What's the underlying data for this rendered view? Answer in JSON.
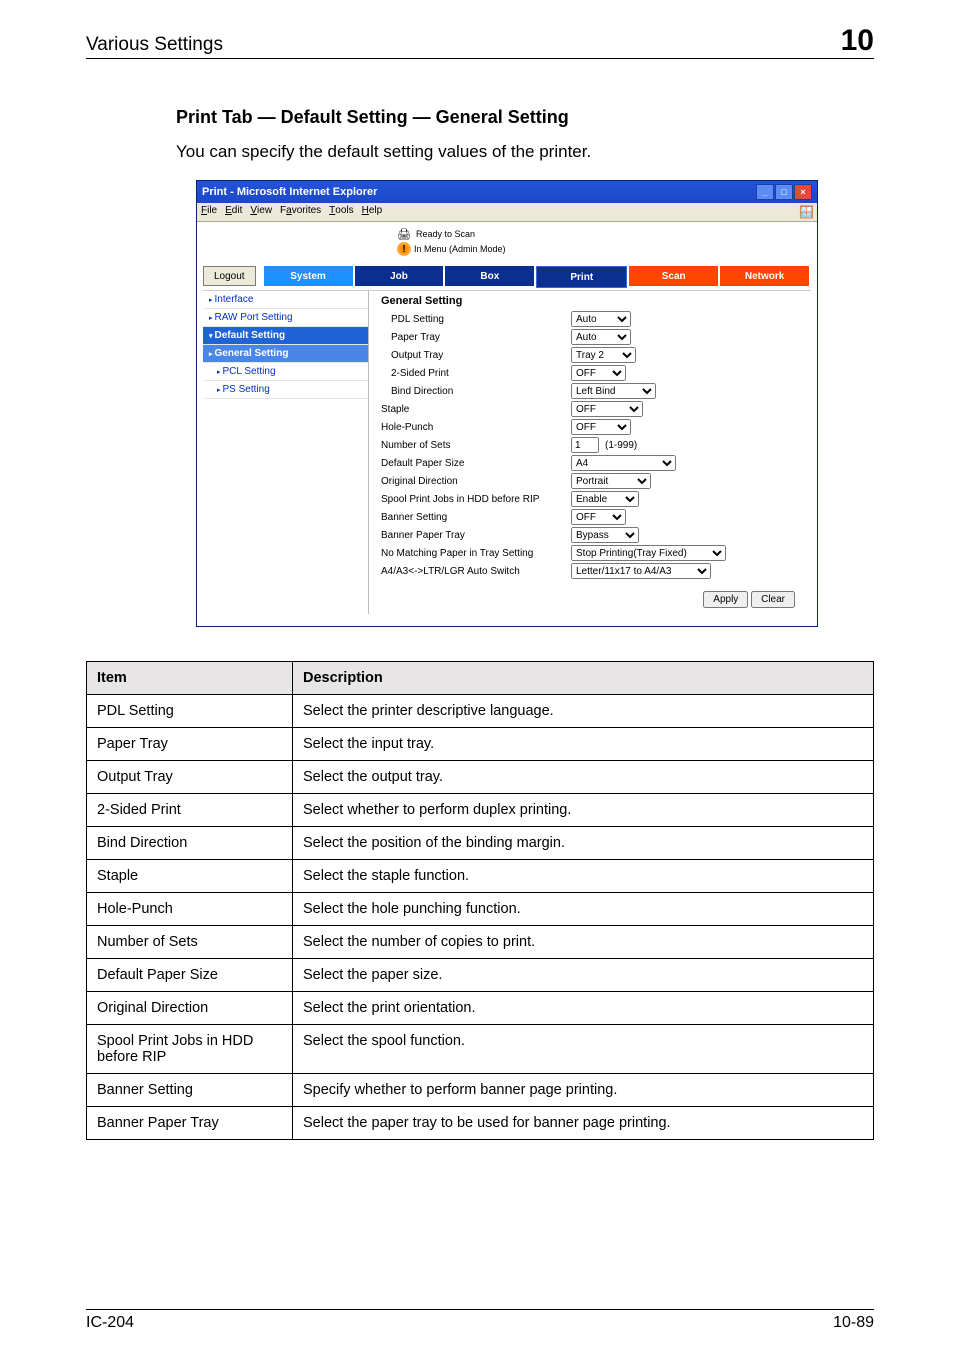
{
  "header": {
    "chapter_title": "Various Settings",
    "chapter_num": "10"
  },
  "section_title": "Print Tab — Default Setting — General Setting",
  "intro": "You can specify the default setting values of the printer.",
  "browser": {
    "title": "Print - Microsoft Internet Explorer",
    "menubar": [
      "File",
      "Edit",
      "View",
      "Favorites",
      "Tools",
      "Help"
    ],
    "status1": "Ready to Scan",
    "status2": "In Menu (Admin Mode)",
    "logout": "Logout",
    "tabs": {
      "system": "System",
      "job": "Job",
      "box": "Box",
      "print": "Print",
      "scan": "Scan",
      "network": "Network"
    },
    "sidebar": [
      "Interface",
      "RAW Port Setting",
      "Default Setting",
      "General Setting",
      "PCL Setting",
      "PS Setting"
    ],
    "main_title": "General Setting",
    "settings": {
      "pdl": {
        "label": "PDL Setting",
        "value": "Auto"
      },
      "paper_tray": {
        "label": "Paper Tray",
        "value": "Auto"
      },
      "output_tray": {
        "label": "Output Tray",
        "value": "Tray 2"
      },
      "duplex": {
        "label": "2-Sided Print",
        "value": "OFF"
      },
      "bind": {
        "label": "Bind Direction",
        "value": "Left Bind"
      },
      "staple": {
        "label": "Staple",
        "value": "OFF"
      },
      "punch": {
        "label": "Hole-Punch",
        "value": "OFF"
      },
      "num_sets": {
        "label": "Number of Sets",
        "value": "1",
        "range": "(1-999)"
      },
      "paper_size": {
        "label": "Default Paper Size",
        "value": "A4"
      },
      "orient": {
        "label": "Original Direction",
        "value": "Portrait"
      },
      "spool": {
        "label": "Spool Print Jobs in HDD before RIP",
        "value": "Enable"
      },
      "banner": {
        "label": "Banner Setting",
        "value": "OFF"
      },
      "banner_tray": {
        "label": "Banner Paper Tray",
        "value": "Bypass"
      },
      "no_match": {
        "label": "No Matching Paper in Tray Setting",
        "value": "Stop Printing(Tray Fixed)"
      },
      "a4a3": {
        "label": "A4/A3<->LTR/LGR Auto Switch",
        "value": "Letter/11x17 to A4/A3"
      }
    },
    "buttons": {
      "apply": "Apply",
      "clear": "Clear"
    }
  },
  "desc_table": {
    "head_item": "Item",
    "head_desc": "Description",
    "rows": [
      {
        "item": "PDL Setting",
        "desc": "Select the printer descriptive language."
      },
      {
        "item": "Paper Tray",
        "desc": "Select the input tray."
      },
      {
        "item": "Output Tray",
        "desc": "Select the output tray."
      },
      {
        "item": "2-Sided Print",
        "desc": "Select whether to perform duplex printing."
      },
      {
        "item": "Bind Direction",
        "desc": "Select the position of the binding margin."
      },
      {
        "item": "Staple",
        "desc": "Select the staple function."
      },
      {
        "item": "Hole-Punch",
        "desc": "Select the hole punching function."
      },
      {
        "item": "Number of Sets",
        "desc": "Select the number of copies to print."
      },
      {
        "item": "Default Paper Size",
        "desc": "Select the paper size."
      },
      {
        "item": "Original Direction",
        "desc": "Select the print orientation."
      },
      {
        "item": "Spool Print Jobs in HDD before RIP",
        "desc": "Select the spool function."
      },
      {
        "item": "Banner Setting",
        "desc": "Specify whether to perform banner page printing."
      },
      {
        "item": "Banner Paper Tray",
        "desc": "Select the paper tray to be used for banner page printing."
      }
    ]
  },
  "footer": {
    "left": "IC-204",
    "right": "10-89"
  }
}
